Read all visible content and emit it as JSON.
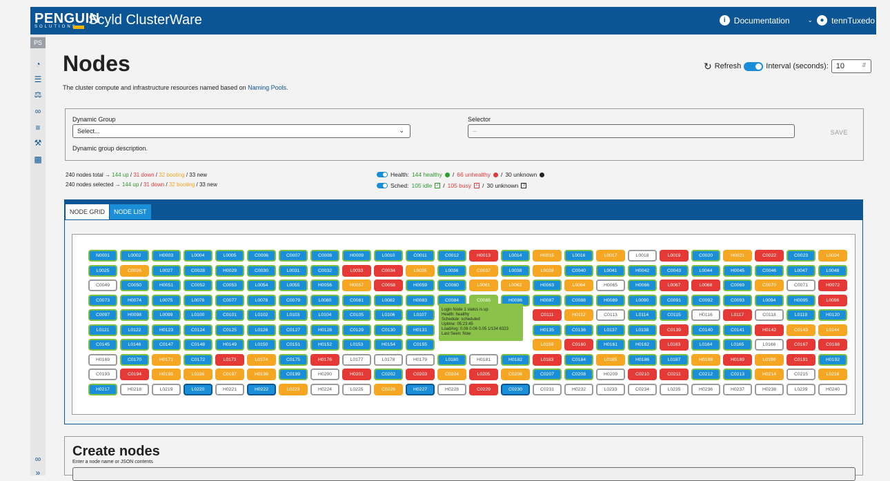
{
  "header": {
    "brand": "PENGUIN",
    "brand_sub": "SOLUTIONS",
    "product": "Scyld ClusterWare",
    "documentation": "Documentation",
    "username": "tennTuxedo"
  },
  "sidebar": {
    "user_initials": "PS",
    "items": [
      "dashboard-icon",
      "database-icon",
      "network-icon",
      "link-icon",
      "list-icon",
      "wrench-icon",
      "chart-icon"
    ],
    "bottom": [
      "link-icon",
      "expand-icon"
    ]
  },
  "page": {
    "title": "Nodes",
    "description": "The cluster compute and infrastructure resources named based on",
    "description_link": "Naming Pools.",
    "refresh": "Refresh",
    "interval_label": "Interval (seconds):",
    "interval_value": "10"
  },
  "group": {
    "dynamic_label": "Dynamic Group",
    "dynamic_placeholder": "Select...",
    "dynamic_desc": "Dynamic group description.",
    "selector_label": "Selector",
    "selector_value": "--",
    "save": "SAVE"
  },
  "stats": {
    "total_prefix": "240 nodes total →",
    "selected_prefix": "240 nodes selected →",
    "up": "144 up",
    "down": "31 down",
    "booting": "32 booting",
    "new": "33 new",
    "health_prefix": "Health:",
    "healthy": "144 healthy",
    "unhealthy": "66 unhealthy",
    "health_unknown": "30 unknown",
    "sched_prefix": "Sched:",
    "idle": "105 idle",
    "busy": "105 busy",
    "sched_unknown": "30 unknown"
  },
  "tabs": {
    "grid": "NODE GRID",
    "list": "NODE LIST"
  },
  "colors": {
    "b": {
      "bg": "#1a8fd8",
      "bd": "#7cc142",
      "fg": "#ffffff"
    },
    "B": {
      "bg": "#1a8fd8",
      "bd": "#0c5594",
      "fg": "#ffffff"
    },
    "o": {
      "bg": "#f5a623",
      "bd": "#f5a623",
      "fg": "#ffffff"
    },
    "r": {
      "bg": "#e53935",
      "bd": "#e53935",
      "fg": "#ffffff"
    },
    "w": {
      "bg": "#ffffff",
      "bd": "#9a9a9a",
      "fg": "#555555"
    },
    "g": {
      "bg": "#8bc34a",
      "bd": "#8bc34a",
      "fg": "#ffffff"
    }
  },
  "nodes": [
    [
      "N0001",
      "b"
    ],
    [
      "L0002",
      "b"
    ],
    [
      "H0003",
      "b"
    ],
    [
      "L0004",
      "b"
    ],
    [
      "L0005",
      "b"
    ],
    [
      "C0006",
      "b"
    ],
    [
      "C0007",
      "b"
    ],
    [
      "C0008",
      "b"
    ],
    [
      "H0009",
      "b"
    ],
    [
      "L0010",
      "b"
    ],
    [
      "C0011",
      "b"
    ],
    [
      "C0012",
      "b"
    ],
    [
      "H0013",
      "r"
    ],
    [
      "L0014",
      "b"
    ],
    [
      "H0015",
      "o"
    ],
    [
      "L0016",
      "b"
    ],
    [
      "L0017",
      "o"
    ],
    [
      "L0018",
      "w"
    ],
    [
      "L0019",
      "r"
    ],
    [
      "C0020",
      "b"
    ],
    [
      "H0021",
      "o"
    ],
    [
      "C0022",
      "r"
    ],
    [
      "C0023",
      "b"
    ],
    [
      "L0024",
      "o"
    ],
    [
      "L0025",
      "b"
    ],
    [
      "C0026",
      "o"
    ],
    [
      "L0027",
      "b"
    ],
    [
      "C0028",
      "b"
    ],
    [
      "H0029",
      "b"
    ],
    [
      "C0030",
      "b"
    ],
    [
      "L0031",
      "b"
    ],
    [
      "C0032",
      "b"
    ],
    [
      "L0033",
      "r"
    ],
    [
      "C0034",
      "r"
    ],
    [
      "L0035",
      "o"
    ],
    [
      "L0036",
      "b"
    ],
    [
      "C0037",
      "o"
    ],
    [
      "L0038",
      "b"
    ],
    [
      "L0039",
      "o"
    ],
    [
      "C0040",
      "b"
    ],
    [
      "L0041",
      "b"
    ],
    [
      "H0042",
      "b"
    ],
    [
      "C0043",
      "b"
    ],
    [
      "L0044",
      "b"
    ],
    [
      "H0045",
      "b"
    ],
    [
      "C0046",
      "b"
    ],
    [
      "L0047",
      "b"
    ],
    [
      "L0048",
      "b"
    ],
    [
      "C0049",
      "w"
    ],
    [
      "C0050",
      "b"
    ],
    [
      "H0051",
      "b"
    ],
    [
      "C0052",
      "b"
    ],
    [
      "C0053",
      "b"
    ],
    [
      "L0054",
      "b"
    ],
    [
      "L0055",
      "b"
    ],
    [
      "H0056",
      "b"
    ],
    [
      "H0057",
      "o"
    ],
    [
      "C0058",
      "r"
    ],
    [
      "H0059",
      "b"
    ],
    [
      "C0060",
      "b"
    ],
    [
      "L0061",
      "o"
    ],
    [
      "L0062",
      "o"
    ],
    [
      "H0063",
      "b"
    ],
    [
      "L0064",
      "o"
    ],
    [
      "H0065",
      "w"
    ],
    [
      "H0066",
      "b"
    ],
    [
      "L0067",
      "r"
    ],
    [
      "L0068",
      "r"
    ],
    [
      "C0069",
      "b"
    ],
    [
      "C0070",
      "o"
    ],
    [
      "C0071",
      "w"
    ],
    [
      "H0072",
      "r"
    ],
    [
      "C0073",
      "b"
    ],
    [
      "H0074",
      "b"
    ],
    [
      "L0075",
      "b"
    ],
    [
      "L0076",
      "b"
    ],
    [
      "C0077",
      "b"
    ],
    [
      "L0078",
      "b"
    ],
    [
      "C0079",
      "b"
    ],
    [
      "L0080",
      "b"
    ],
    [
      "C0081",
      "b"
    ],
    [
      "L0082",
      "b"
    ],
    [
      "H0083",
      "b"
    ],
    [
      "C0084",
      "b"
    ],
    [
      "C0085",
      "g"
    ],
    [
      "H0086",
      "b"
    ],
    [
      "H0087",
      "b"
    ],
    [
      "C0088",
      "b"
    ],
    [
      "H0089",
      "b"
    ],
    [
      "L0090",
      "b"
    ],
    [
      "C0091",
      "b"
    ],
    [
      "C0092",
      "b"
    ],
    [
      "C0093",
      "b"
    ],
    [
      "L0094",
      "b"
    ],
    [
      "H0095",
      "b"
    ],
    [
      "L0096",
      "r"
    ],
    [
      "C0097",
      "b"
    ],
    [
      "H0098",
      "b"
    ],
    [
      "L0099",
      "b"
    ],
    [
      "L0100",
      "b"
    ],
    [
      "C0101",
      "b"
    ],
    [
      "L0102",
      "b"
    ],
    [
      "L0103",
      "b"
    ],
    [
      "L0104",
      "b"
    ],
    [
      "C0105",
      "b"
    ],
    [
      "L0106",
      "b"
    ],
    [
      "L0107",
      "b"
    ],
    [
      "",
      ""
    ],
    [
      "",
      ""
    ],
    [
      "",
      ""
    ],
    [
      "C0111",
      "r"
    ],
    [
      "H0112",
      "o"
    ],
    [
      "C0113",
      "w"
    ],
    [
      "L0114",
      "b"
    ],
    [
      "C0115",
      "b"
    ],
    [
      "H0116",
      "w"
    ],
    [
      "L0117",
      "r"
    ],
    [
      "C0118",
      "w"
    ],
    [
      "L0119",
      "b"
    ],
    [
      "H0120",
      "b"
    ],
    [
      "L0121",
      "b"
    ],
    [
      "L0122",
      "b"
    ],
    [
      "H0123",
      "b"
    ],
    [
      "C0124",
      "b"
    ],
    [
      "C0125",
      "b"
    ],
    [
      "L0126",
      "b"
    ],
    [
      "C0127",
      "b"
    ],
    [
      "H0128",
      "b"
    ],
    [
      "C0129",
      "b"
    ],
    [
      "C0130",
      "b"
    ],
    [
      "H0131",
      "b"
    ],
    [
      "",
      ""
    ],
    [
      "",
      ""
    ],
    [
      "",
      ""
    ],
    [
      "H0135",
      "b"
    ],
    [
      "C0136",
      "b"
    ],
    [
      "L0137",
      "b"
    ],
    [
      "L0138",
      "b"
    ],
    [
      "C0139",
      "r"
    ],
    [
      "C0140",
      "b"
    ],
    [
      "C0141",
      "b"
    ],
    [
      "H0142",
      "r"
    ],
    [
      "C0143",
      "o"
    ],
    [
      "L0144",
      "o"
    ],
    [
      "C0145",
      "b"
    ],
    [
      "L0146",
      "b"
    ],
    [
      "C0147",
      "b"
    ],
    [
      "C0148",
      "b"
    ],
    [
      "H0149",
      "b"
    ],
    [
      "L0150",
      "b"
    ],
    [
      "C0151",
      "b"
    ],
    [
      "H0152",
      "b"
    ],
    [
      "L0153",
      "b"
    ],
    [
      "H0154",
      "b"
    ],
    [
      "C0155",
      "b"
    ],
    [
      "",
      ""
    ],
    [
      "",
      ""
    ],
    [
      "",
      ""
    ],
    [
      "L0159",
      "o"
    ],
    [
      "C0160",
      "r"
    ],
    [
      "H0161",
      "b"
    ],
    [
      "H0162",
      "b"
    ],
    [
      "L0163",
      "r"
    ],
    [
      "L0164",
      "b"
    ],
    [
      "L0165",
      "b"
    ],
    [
      "L0166",
      "w"
    ],
    [
      "C0167",
      "r"
    ],
    [
      "C0168",
      "r"
    ],
    [
      "H0169",
      "w"
    ],
    [
      "C0170",
      "b"
    ],
    [
      "H0171",
      "o"
    ],
    [
      "C0172",
      "b"
    ],
    [
      "L0173",
      "r"
    ],
    [
      "L0174",
      "o"
    ],
    [
      "C0175",
      "b"
    ],
    [
      "H0176",
      "r"
    ],
    [
      "L0177",
      "w"
    ],
    [
      "L0178",
      "w"
    ],
    [
      "H0179",
      "w"
    ],
    [
      "L0180",
      "b"
    ],
    [
      "H0181",
      "w"
    ],
    [
      "H0182",
      "b"
    ],
    [
      "L0183",
      "r"
    ],
    [
      "C0184",
      "b"
    ],
    [
      "L0185",
      "o"
    ],
    [
      "H0186",
      "b"
    ],
    [
      "L0187",
      "b"
    ],
    [
      "H0188",
      "o"
    ],
    [
      "H0189",
      "r"
    ],
    [
      "L0190",
      "o"
    ],
    [
      "C0191",
      "r"
    ],
    [
      "H0192",
      "b"
    ],
    [
      "C0193",
      "w"
    ],
    [
      "C0194",
      "r"
    ],
    [
      "H0195",
      "o"
    ],
    [
      "L0196",
      "o"
    ],
    [
      "C0197",
      "o"
    ],
    [
      "H0198",
      "o"
    ],
    [
      "C0199",
      "b"
    ],
    [
      "H0200",
      "w"
    ],
    [
      "H0201",
      "r"
    ],
    [
      "C0202",
      "b"
    ],
    [
      "C0203",
      "r"
    ],
    [
      "C0204",
      "o"
    ],
    [
      "L0205",
      "r"
    ],
    [
      "C0206",
      "o"
    ],
    [
      "C0207",
      "b"
    ],
    [
      "C0208",
      "b"
    ],
    [
      "H0209",
      "w"
    ],
    [
      "C0210",
      "r"
    ],
    [
      "C0211",
      "r"
    ],
    [
      "C0212",
      "b"
    ],
    [
      "C0213",
      "b"
    ],
    [
      "H0214",
      "o"
    ],
    [
      "C0215",
      "w"
    ],
    [
      "L0216",
      "o"
    ],
    [
      "H0217",
      "b"
    ],
    [
      "H0218",
      "w"
    ],
    [
      "L0219",
      "w"
    ],
    [
      "L0220",
      "B"
    ],
    [
      "H0221",
      "w"
    ],
    [
      "H0222",
      "B"
    ],
    [
      "L0223",
      "o"
    ],
    [
      "H0224",
      "w"
    ],
    [
      "L0225",
      "w"
    ],
    [
      "C0226",
      "o"
    ],
    [
      "H0227",
      "B"
    ],
    [
      "H0228",
      "w"
    ],
    [
      "C0229",
      "r"
    ],
    [
      "C0230",
      "B"
    ],
    [
      "C0231",
      "w"
    ],
    [
      "H0232",
      "w"
    ],
    [
      "L0233",
      "w"
    ],
    [
      "C0234",
      "w"
    ],
    [
      "L0235",
      "w"
    ],
    [
      "H0236",
      "w"
    ],
    [
      "H0237",
      "w"
    ],
    [
      "H0238",
      "w"
    ],
    [
      "L0239",
      "w"
    ],
    [
      "H0240",
      "w"
    ]
  ],
  "tooltip": {
    "l1": "Login Node 1 status is up",
    "l2": "Health: healthy",
    "l3": "Schedule: scheduled",
    "l4": "Uptime: 05:23:45",
    "l5": "LoadAvg: 0.06 0.06 0.05 1/134 6323",
    "l6": "Last Seen: Now"
  },
  "create": {
    "title": "Create nodes",
    "hint": "Enter a node name or JSON contents"
  }
}
